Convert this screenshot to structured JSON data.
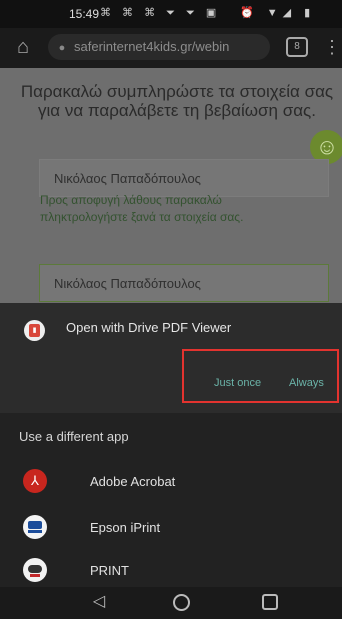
{
  "status_bar": {
    "time": "15:49",
    "icons": "⌘ ⌘ ⌘ ⏷ ⏷ ▣",
    "right_icons": "⏰ ▼◢ ▮"
  },
  "browser": {
    "url": "saferinternet4kids.gr/webin",
    "tab_count": "8"
  },
  "page": {
    "intro": "Παρακαλώ συμπληρώστε τα στοιχεία σας για να παραλάβετε τη βεβαίωση σας.",
    "field1_value": "Νικόλαος Παπαδόπουλος",
    "warning": "Προς αποφυγή λάθους παρακαλώ πληκτρολογήστε ξανά τα στοιχεία σας.",
    "field2_value": "Νικόλαος Παπαδόπουλος"
  },
  "sheet": {
    "open_with": "Open with Drive PDF Viewer",
    "just_once": "Just once",
    "always": "Always",
    "use_different": "Use a different app",
    "apps": [
      {
        "label": "Adobe Acrobat",
        "icon": "adobe-acrobat-icon"
      },
      {
        "label": "Epson iPrint",
        "icon": "epson-iprint-icon"
      },
      {
        "label": "PRINT",
        "icon": "canon-print-icon"
      }
    ],
    "highlight_color": "#e3332f",
    "accent_color": "#6bb3a8"
  }
}
